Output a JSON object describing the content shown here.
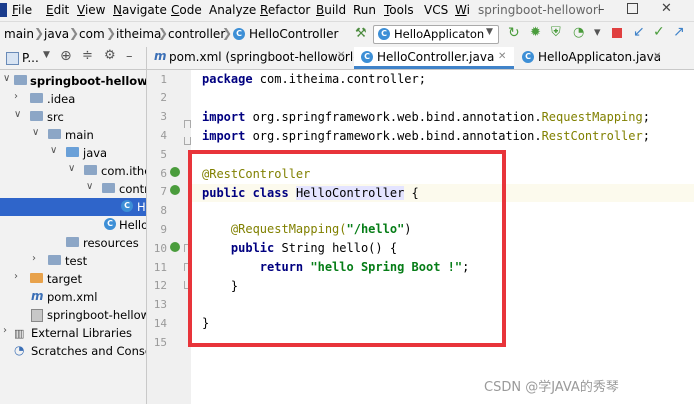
{
  "menu": {
    "items": [
      {
        "label": "File",
        "mnemonic": "F",
        "rest": "ile"
      },
      {
        "label": "Edit",
        "mnemonic": "E",
        "rest": "dit"
      },
      {
        "label": "View",
        "mnemonic": "V",
        "rest": "iew"
      },
      {
        "label": "Navigate",
        "mnemonic": "N",
        "rest": "avigate"
      },
      {
        "label": "Code",
        "mnemonic": "C",
        "rest": "ode"
      },
      {
        "label": "Analyze",
        "mnemonic": "",
        "rest": "Analyze"
      },
      {
        "label": "Refactor",
        "mnemonic": "R",
        "rest": "efactor"
      },
      {
        "label": "Build",
        "mnemonic": "B",
        "rest": "uild"
      },
      {
        "label": "Run",
        "mnemonic": "",
        "rest": "Run"
      },
      {
        "label": "Tools",
        "mnemonic": "T",
        "rest": "ools"
      },
      {
        "label": "VCS",
        "mnemonic": "",
        "rest": "VCS"
      },
      {
        "label": "Wi",
        "mnemonic": "W",
        "rest": "i"
      }
    ],
    "window_title": "springboot-helloworl"
  },
  "breadcrumbs": [
    "main",
    "java",
    "com",
    "itheima",
    "controller",
    "HelloController"
  ],
  "run_config": "HelloApplicaton",
  "project_panel": {
    "title": "P...",
    "tree": [
      {
        "label": "springboot-helloworld",
        "bold": true
      },
      {
        "label": ".idea"
      },
      {
        "label": "src"
      },
      {
        "label": "main"
      },
      {
        "label": "java"
      },
      {
        "label": "com.ithe"
      },
      {
        "label": "contr"
      },
      {
        "label": "H"
      },
      {
        "label": "Hello"
      },
      {
        "label": "resources"
      },
      {
        "label": "test"
      },
      {
        "label": "target"
      },
      {
        "label": "pom.xml"
      },
      {
        "label": "springboot-hellow"
      },
      {
        "label": "External Libraries"
      },
      {
        "label": "Scratches and Console"
      }
    ]
  },
  "tabs": [
    {
      "label": "pom.xml (springboot-helloworld)",
      "icon": "m"
    },
    {
      "label": "HelloController.java",
      "icon": "C"
    },
    {
      "label": "HelloApplicaton.java",
      "icon": "C"
    }
  ],
  "editor": {
    "line_numbers": [
      "1",
      "2",
      "3",
      "4",
      "5",
      "6",
      "7",
      "8",
      "9",
      "10",
      "11",
      "12",
      "13",
      "14",
      "15"
    ],
    "code": {
      "l1_kw": "package",
      "l1_rest": " com.itheima.controller;",
      "l3_kw": "import",
      "l3_rest": " org.springframework.web.bind.annotation.",
      "l3_cls": "RequestMapping",
      "l4_kw": "import",
      "l4_rest": " org.springframework.web.bind.annotation.",
      "l4_cls": "RestController",
      "l6_ann": "@RestController",
      "l7_kw": "public class",
      "l7_name": "HelloController",
      "l7_rest": " {",
      "l9_ann": "@RequestMapping(",
      "l9_str": "\"/hello\"",
      "l9_end": ")",
      "l10_kw": "public",
      "l10_rest": " String hello() {",
      "l11_kw": "return",
      "l11_str": " \"hello Spring Boot !\"",
      "l11_end": ";",
      "l12": "}",
      "l14": "}",
      "l11_semicolon": ";"
    }
  },
  "watermark": "CSDN @学JAVA的秀琴",
  "colors": {
    "highlight_box": "#e8343a",
    "keyword": "#000080",
    "annotation": "#808000",
    "string": "#067d17",
    "selection": "#2f65ca"
  }
}
